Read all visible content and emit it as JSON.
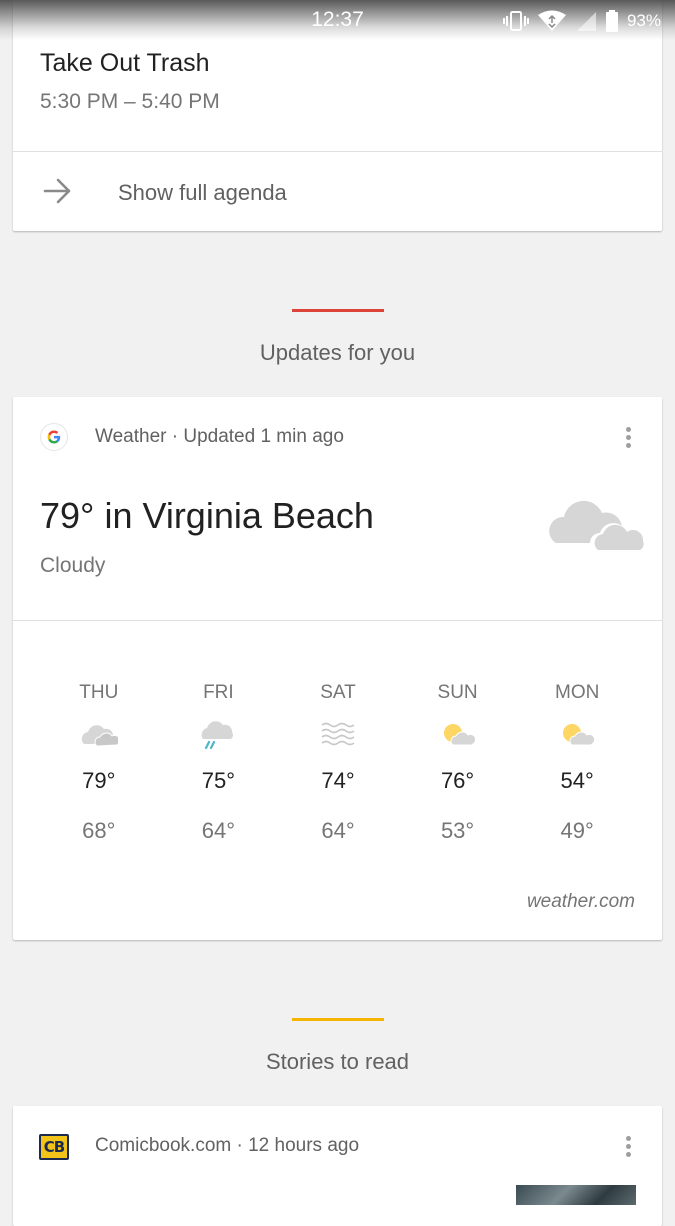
{
  "status_bar": {
    "time": "12:37",
    "battery": "93%",
    "icons": [
      "vibrate-icon",
      "wifi-icon",
      "signal-icon",
      "battery-icon"
    ]
  },
  "agenda": {
    "event_title": "Take Out Trash",
    "event_time": "5:30 PM – 5:40 PM",
    "link_label": "Show full agenda"
  },
  "updates_section": {
    "title": "Updates for you",
    "accent": "#db4437"
  },
  "weather": {
    "source": "Weather · Updated 1 min ago",
    "headline": "79° in Virginia Beach",
    "condition": "Cloudy",
    "attribution": "weather.com",
    "forecast": [
      {
        "day": "THU",
        "icon": "cloudy-icon",
        "high": "79°",
        "low": "68°"
      },
      {
        "day": "FRI",
        "icon": "rain-icon",
        "high": "75°",
        "low": "64°"
      },
      {
        "day": "SAT",
        "icon": "haze-icon",
        "high": "74°",
        "low": "64°"
      },
      {
        "day": "SUN",
        "icon": "partly-sunny-icon",
        "high": "76°",
        "low": "53°"
      },
      {
        "day": "MON",
        "icon": "partly-sunny-icon",
        "high": "54°",
        "low": "49°"
      }
    ]
  },
  "stories_section": {
    "title": "Stories to read",
    "accent": "#f4b400"
  },
  "story": {
    "logo_text": "CB",
    "source": "Comicbook.com · 12 hours ago"
  }
}
